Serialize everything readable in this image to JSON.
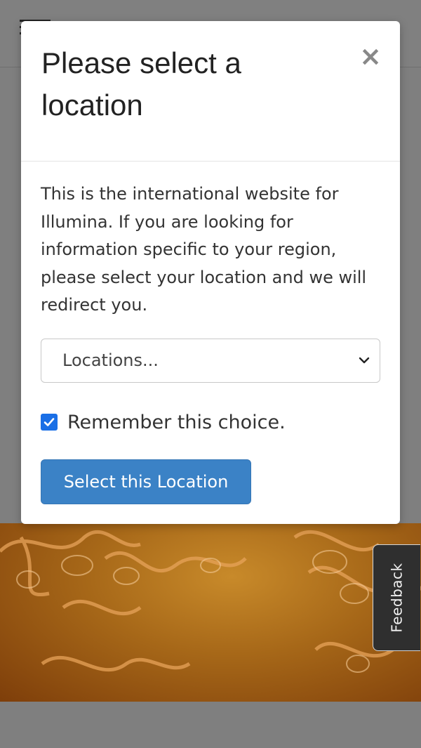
{
  "modal": {
    "title": "Please select a location",
    "close_label": "×",
    "body_text": "This is the international website for Illumina. If you are looking for information specific to your region, please select your location and we will redirect you.",
    "location_select": {
      "selected_value": "Locations..."
    },
    "remember_checkbox": {
      "checked": true,
      "label": "Remember this choice."
    },
    "submit_label": "Select this Location"
  },
  "feedback_tab": {
    "label": "Feedback"
  },
  "colors": {
    "primary_button": "#3b82c6",
    "checkbox_accent": "#1a6fe6",
    "overlay": "#7f7f7f",
    "feedback_bg": "#2f2f2f"
  },
  "icons": {
    "close": "close-icon",
    "select_arrow": "chevron-down-icon",
    "checkbox": "checkmark-icon",
    "menu": "hamburger-menu-icon"
  }
}
